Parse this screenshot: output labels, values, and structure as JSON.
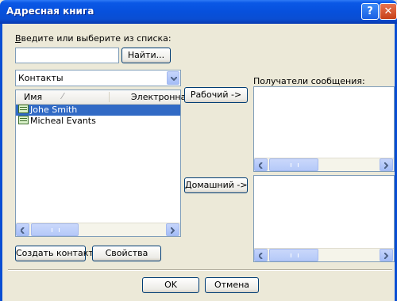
{
  "window": {
    "title": "Адресная книга",
    "help": "?",
    "close": "✕"
  },
  "search": {
    "label_underlined": "В",
    "label_rest": "ведите или выберите из списка:",
    "value": "",
    "find_button": "Найти..."
  },
  "source_combo": {
    "value": "Контакты"
  },
  "contacts": {
    "columns": [
      "Имя",
      "Электронная"
    ],
    "rows": [
      {
        "name": "Johe Smith",
        "selected": true
      },
      {
        "name": "Micheal Evants",
        "selected": false
      }
    ]
  },
  "recipients": {
    "label": "Получатели сообщения:",
    "work_button": "Рабочий ->",
    "home_button": "Домашний ->"
  },
  "buttons": {
    "create_contact": "Создать контакт",
    "properties": "Свойства",
    "ok": "OK",
    "cancel": "Отмена"
  },
  "colors": {
    "titlebar": "#0750dc",
    "selection": "#316ac5",
    "dialog_bg": "#ece9d8"
  }
}
